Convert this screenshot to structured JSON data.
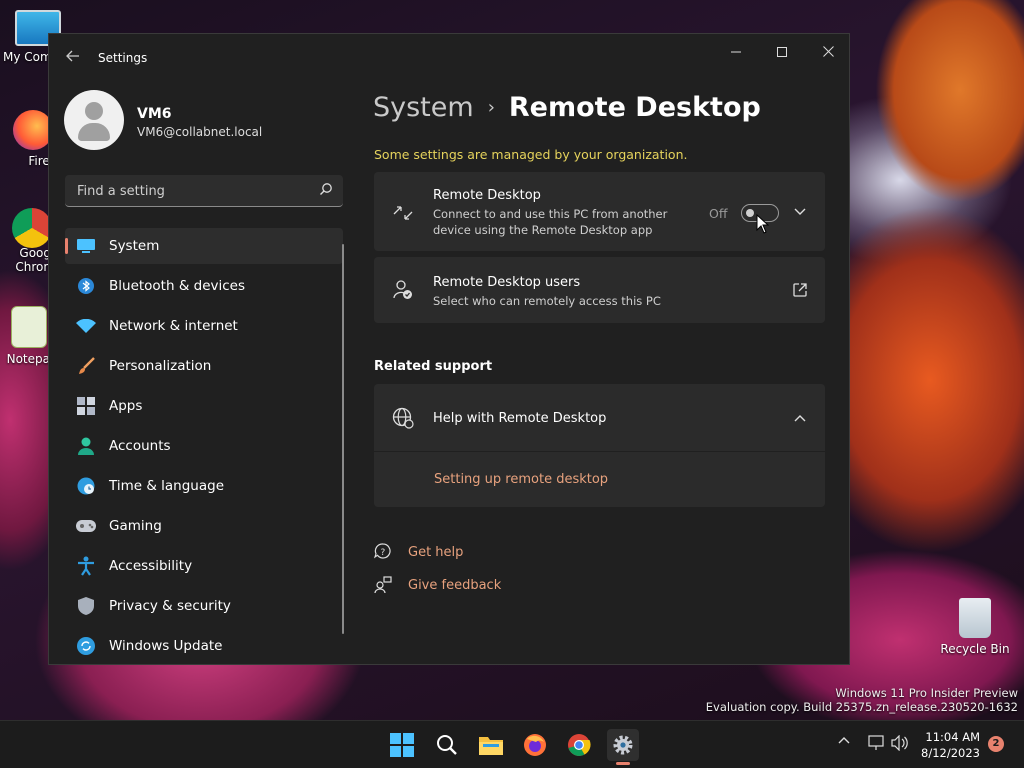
{
  "desktop": {
    "icons": [
      {
        "label": "My Com"
      },
      {
        "label": "Firef"
      },
      {
        "label": "Goog"
      },
      {
        "label": "Chron"
      },
      {
        "label": "Notepa"
      },
      {
        "label": "Recycle Bin"
      }
    ],
    "watermark": {
      "line1": "Windows 11 Pro Insider Preview",
      "line2": "Evaluation copy. Build 25375.zn_release.230520-1632"
    }
  },
  "window": {
    "app_title": "Settings",
    "controls": {
      "minimize": "—",
      "maximize": "☐",
      "close": "✕"
    }
  },
  "sidebar": {
    "user": {
      "name": "VM6",
      "email": "VM6@collabnet.local"
    },
    "search": {
      "placeholder": "Find a setting"
    },
    "items": [
      {
        "label": "System",
        "icon": "system-icon",
        "active": true
      },
      {
        "label": "Bluetooth & devices",
        "icon": "bluetooth-icon"
      },
      {
        "label": "Network & internet",
        "icon": "wifi-icon"
      },
      {
        "label": "Personalization",
        "icon": "brush-icon"
      },
      {
        "label": "Apps",
        "icon": "apps-icon"
      },
      {
        "label": "Accounts",
        "icon": "accounts-icon"
      },
      {
        "label": "Time & language",
        "icon": "globe-clock-icon"
      },
      {
        "label": "Gaming",
        "icon": "gamepad-icon"
      },
      {
        "label": "Accessibility",
        "icon": "accessibility-icon"
      },
      {
        "label": "Privacy & security",
        "icon": "shield-icon"
      },
      {
        "label": "Windows Update",
        "icon": "update-icon"
      }
    ]
  },
  "main": {
    "breadcrumb": {
      "parent": "System",
      "separator": "›",
      "current": "Remote Desktop"
    },
    "org_note": "Some settings are managed by your organization.",
    "remote_desktop_card": {
      "title": "Remote Desktop",
      "desc_line1": "Connect to and use this PC from another",
      "desc_line2": "device using the Remote Desktop app",
      "toggle_label": "Off",
      "toggle_on": false
    },
    "users_card": {
      "title": "Remote Desktop users",
      "desc": "Select who can remotely access this PC"
    },
    "related_support": {
      "title": "Related support",
      "help_title": "Help with Remote Desktop",
      "help_link": "Setting up remote desktop"
    },
    "footer": {
      "get_help": "Get help",
      "give_feedback": "Give feedback"
    }
  },
  "taskbar": {
    "clock_time": "11:04 AM",
    "clock_date": "8/12/2023",
    "notification_count": "2"
  },
  "colors": {
    "accent": "#e8826e",
    "org_note": "#e6d35c",
    "link": "#e8a27e"
  }
}
